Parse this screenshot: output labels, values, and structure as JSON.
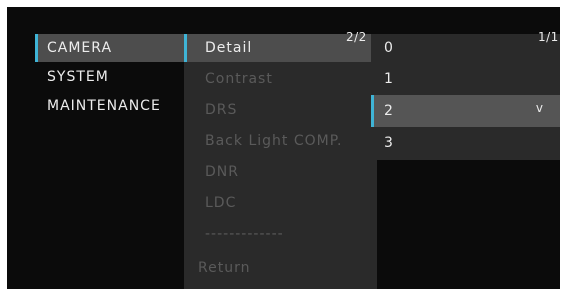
{
  "main_menu": {
    "items": [
      {
        "label": "CAMERA",
        "selected": true
      },
      {
        "label": "SYSTEM",
        "selected": false
      },
      {
        "label": "MAINTENANCE",
        "selected": false
      }
    ]
  },
  "sub_menu": {
    "page": "2/2",
    "items": [
      {
        "label": "Detail",
        "selected": true,
        "enabled": true
      },
      {
        "label": "Contrast",
        "selected": false,
        "enabled": false
      },
      {
        "label": "DRS",
        "selected": false,
        "enabled": false
      },
      {
        "label": "Back Light COMP.",
        "selected": false,
        "enabled": false
      },
      {
        "label": "DNR",
        "selected": false,
        "enabled": false
      },
      {
        "label": "LDC",
        "selected": false,
        "enabled": false
      },
      {
        "label": "-------------",
        "selected": false,
        "enabled": false
      },
      {
        "label": "Return",
        "selected": false,
        "enabled": false
      }
    ]
  },
  "options": {
    "page": "1/1",
    "items": [
      {
        "label": "0",
        "selected": false
      },
      {
        "label": "1",
        "selected": false
      },
      {
        "label": "2",
        "selected": true,
        "marker": "v"
      },
      {
        "label": "3",
        "selected": false
      }
    ]
  },
  "colors": {
    "background": "#0b0b0b",
    "panel": "#2a2a2a",
    "selected_row": "#4d4d4d",
    "accent": "#3fb4d6",
    "text": "#ececec",
    "disabled_text": "#5a5a5a"
  }
}
